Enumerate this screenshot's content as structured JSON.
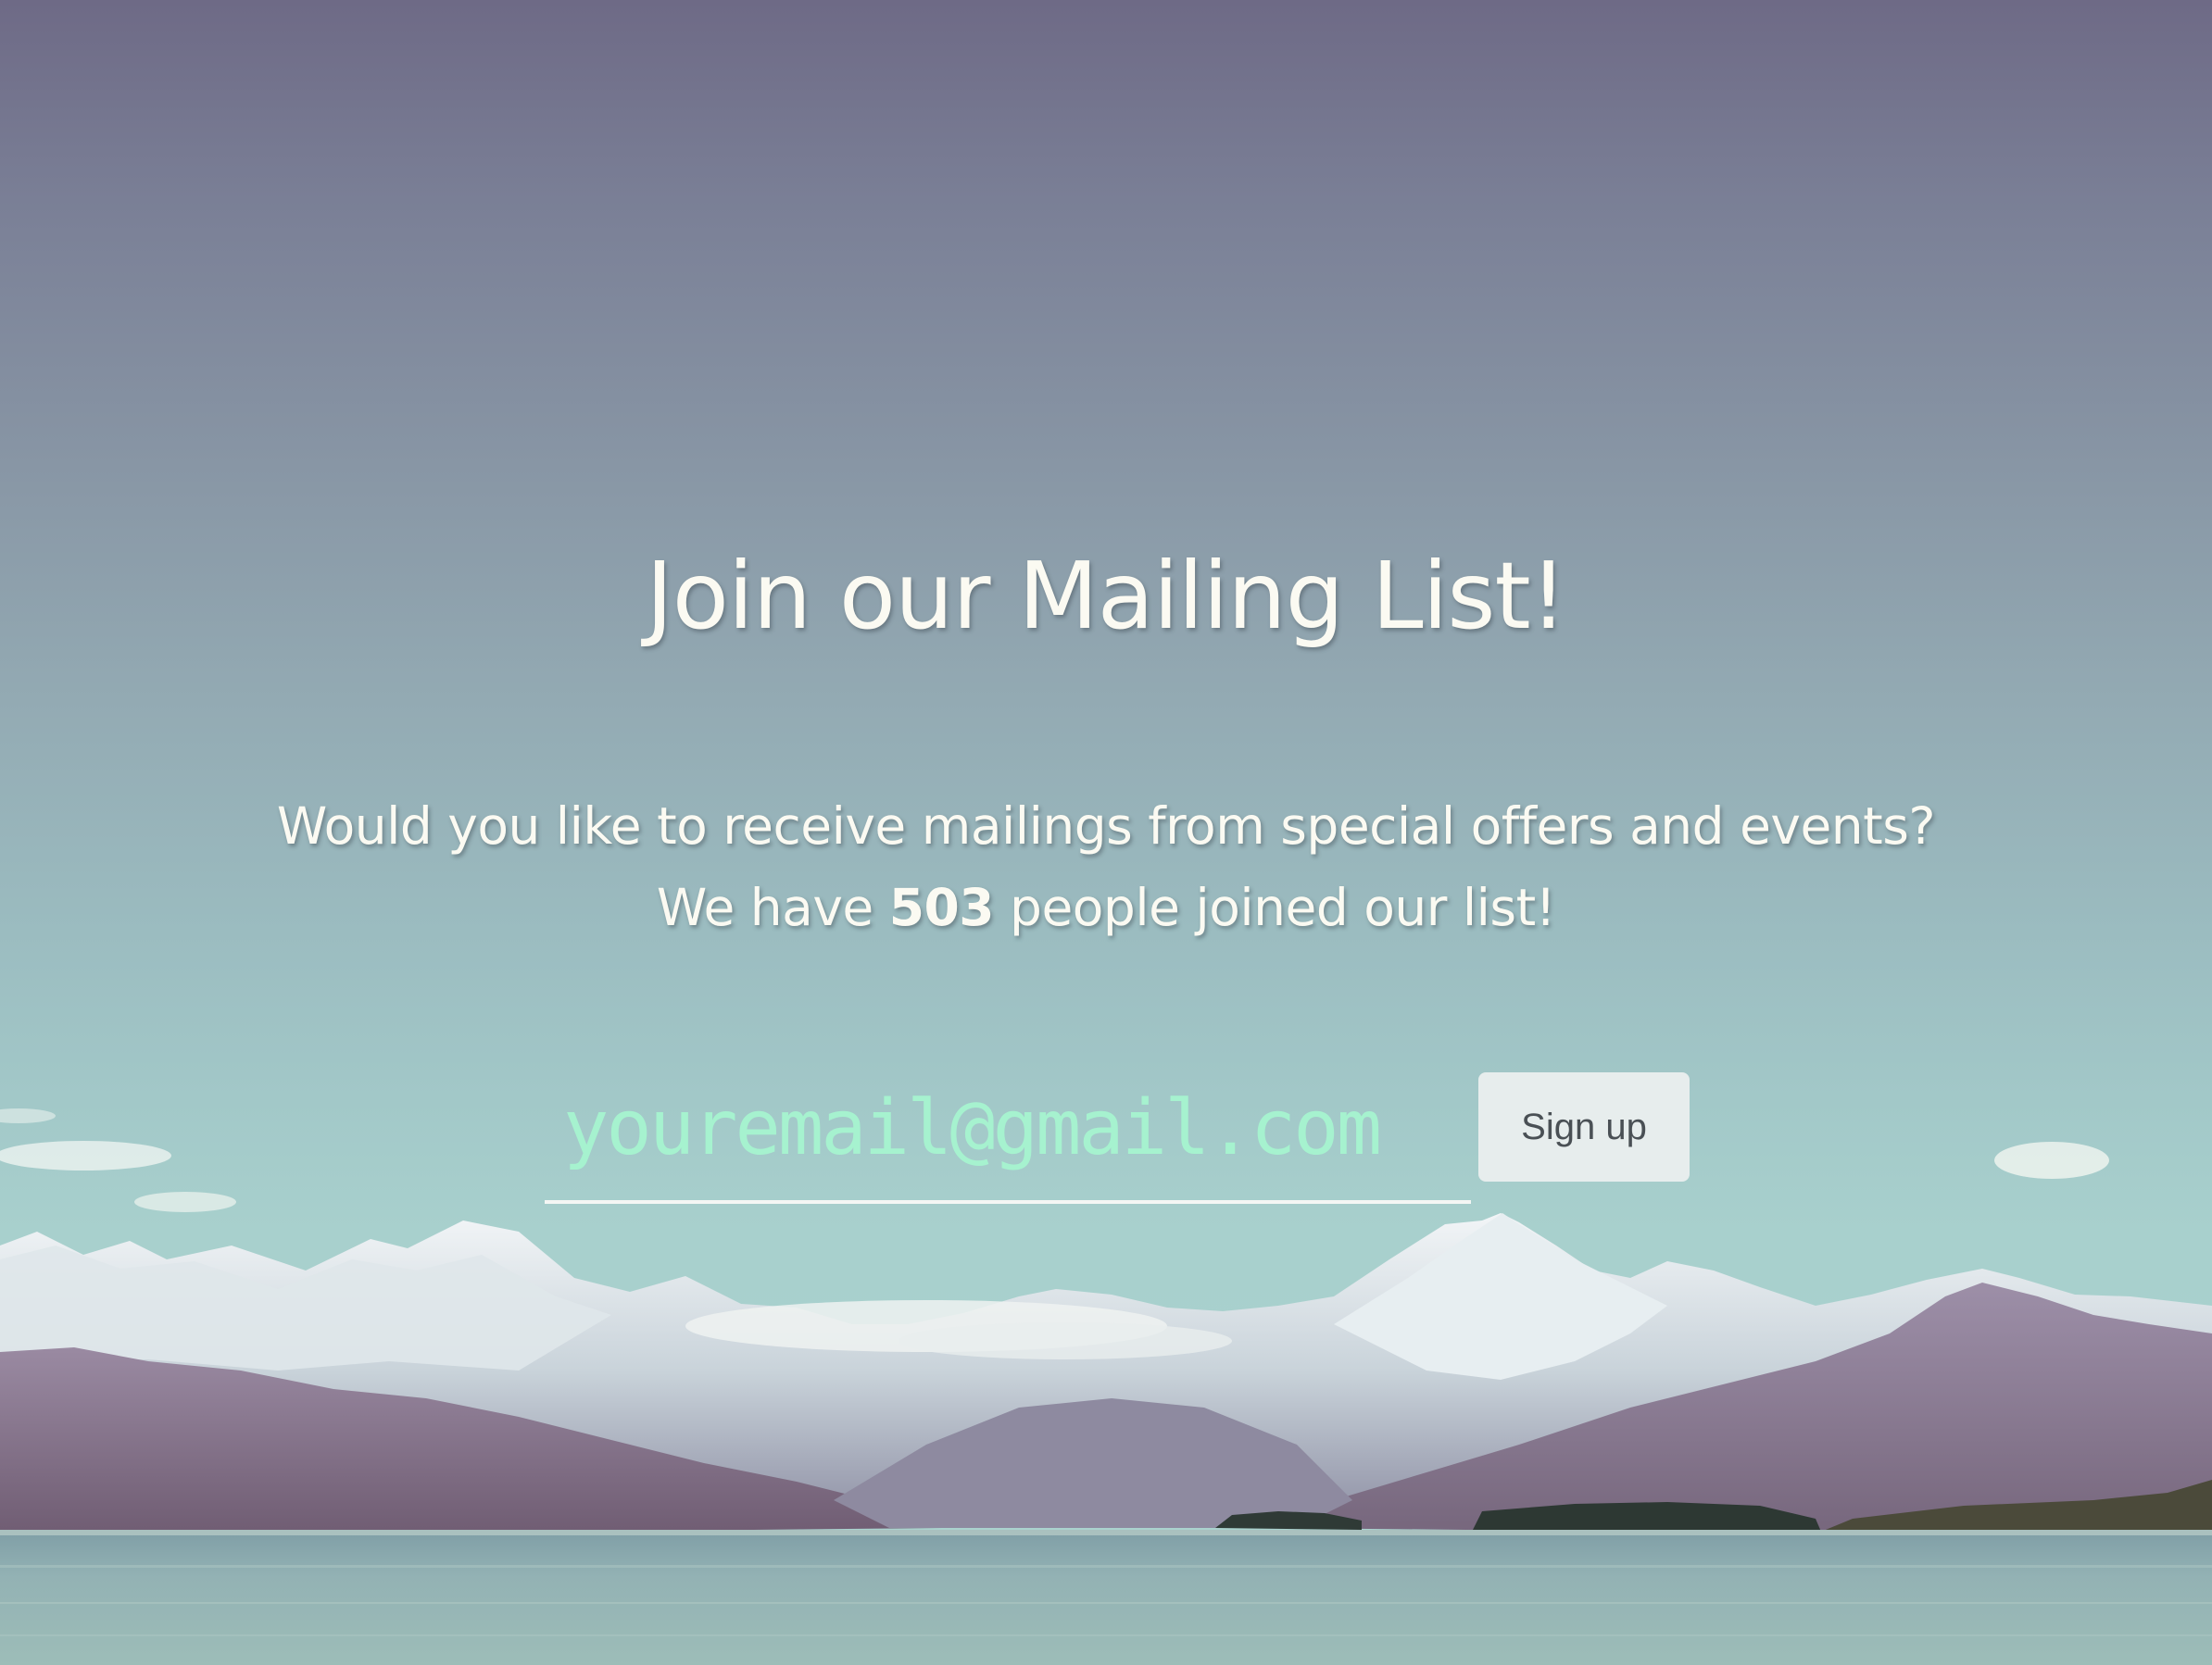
{
  "headline": "Join our Mailing List!",
  "subtext": {
    "line1": "Would you like to receive mailings from special offers and events?",
    "line2_prefix": "We have ",
    "count": "503",
    "line2_suffix": " people joined our list!"
  },
  "form": {
    "email_placeholder": "youremail@gmail.com",
    "signup_label": "Sign up"
  },
  "colors": {
    "text": "#fbfaf2",
    "placeholder": "#a6f2cf",
    "button_bg": "#e7eded",
    "button_text": "#4a5055"
  }
}
